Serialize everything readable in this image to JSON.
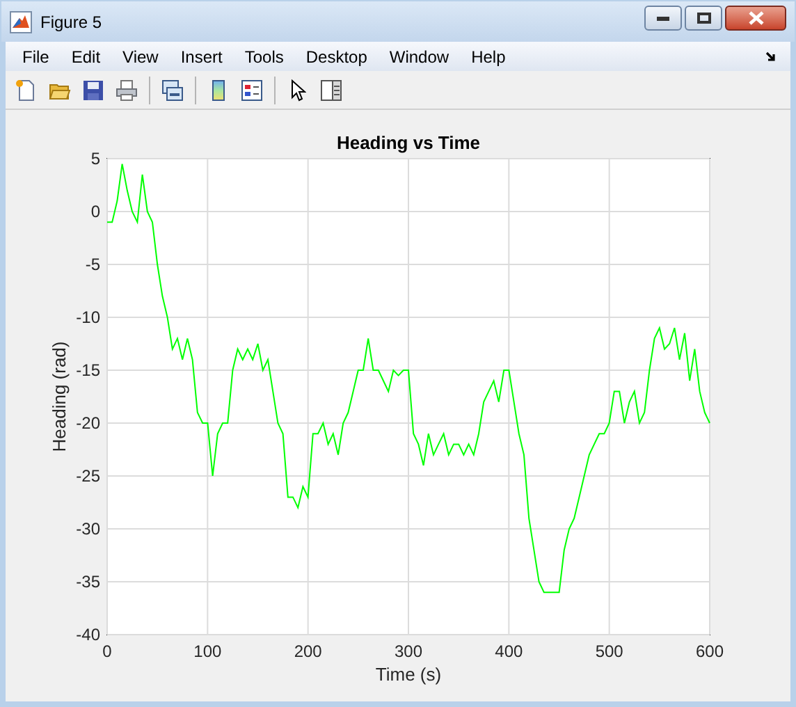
{
  "window": {
    "title": "Figure 5"
  },
  "menu": [
    "File",
    "Edit",
    "View",
    "Insert",
    "Tools",
    "Desktop",
    "Window",
    "Help"
  ],
  "chart_data": {
    "type": "line",
    "grid": true,
    "title": "Heading vs Time",
    "xlabel": "Time (s)",
    "ylabel": "Heading (rad)",
    "xlim": [
      0,
      600
    ],
    "ylim": [
      -40,
      5
    ],
    "xticks": [
      0,
      100,
      200,
      300,
      400,
      500,
      600
    ],
    "yticks": [
      -40,
      -35,
      -30,
      -25,
      -20,
      -15,
      -10,
      -5,
      0,
      5
    ],
    "x": [
      0,
      5,
      10,
      15,
      20,
      25,
      30,
      35,
      40,
      45,
      50,
      55,
      60,
      65,
      70,
      75,
      80,
      85,
      90,
      95,
      100,
      105,
      110,
      115,
      120,
      125,
      130,
      135,
      140,
      145,
      150,
      155,
      160,
      165,
      170,
      175,
      180,
      185,
      190,
      195,
      200,
      205,
      210,
      215,
      220,
      225,
      230,
      235,
      240,
      245,
      250,
      255,
      260,
      265,
      270,
      275,
      280,
      285,
      290,
      295,
      300,
      305,
      310,
      315,
      320,
      325,
      330,
      335,
      340,
      345,
      350,
      355,
      360,
      365,
      370,
      375,
      380,
      385,
      390,
      395,
      400,
      405,
      410,
      415,
      420,
      425,
      430,
      435,
      440,
      445,
      450,
      455,
      460,
      465,
      470,
      475,
      480,
      485,
      490,
      495,
      500,
      505,
      510,
      515,
      520,
      525,
      530,
      535,
      540,
      545,
      550,
      555,
      560,
      565,
      570,
      575,
      580,
      585,
      590,
      595,
      600
    ],
    "series": [
      {
        "color": "#00ff00",
        "values": [
          -1,
          -1,
          1,
          4.5,
          2,
          0,
          -1,
          3.5,
          0,
          -1,
          -5,
          -8,
          -10,
          -13,
          -12,
          -14,
          -12,
          -14,
          -19,
          -20,
          -20,
          -25,
          -21,
          -20,
          -20,
          -15,
          -13,
          -14,
          -13,
          -14,
          -12.5,
          -15,
          -14,
          -17,
          -20,
          -21,
          -27,
          -27,
          -28,
          -26,
          -27,
          -21,
          -21,
          -20,
          -22,
          -21,
          -23,
          -20,
          -19,
          -17,
          -15,
          -15,
          -12,
          -15,
          -15,
          -16,
          -17,
          -15,
          -15.5,
          -15,
          -15,
          -21,
          -22,
          -24,
          -21,
          -23,
          -22,
          -21,
          -23,
          -22,
          -22,
          -23,
          -22,
          -23,
          -21,
          -18,
          -17,
          -16,
          -18,
          -15,
          -15,
          -18,
          -21,
          -23,
          -29,
          -32,
          -35,
          -36,
          -36,
          -36,
          -36,
          -32,
          -30,
          -29,
          -27,
          -25,
          -23,
          -22,
          -21,
          -21,
          -20,
          -17,
          -17,
          -20,
          -18,
          -17,
          -20,
          -19,
          -15,
          -12,
          -11,
          -13,
          -12.5,
          -11,
          -14,
          -11.5,
          -16,
          -13,
          -17,
          -19,
          -20
        ]
      }
    ]
  }
}
